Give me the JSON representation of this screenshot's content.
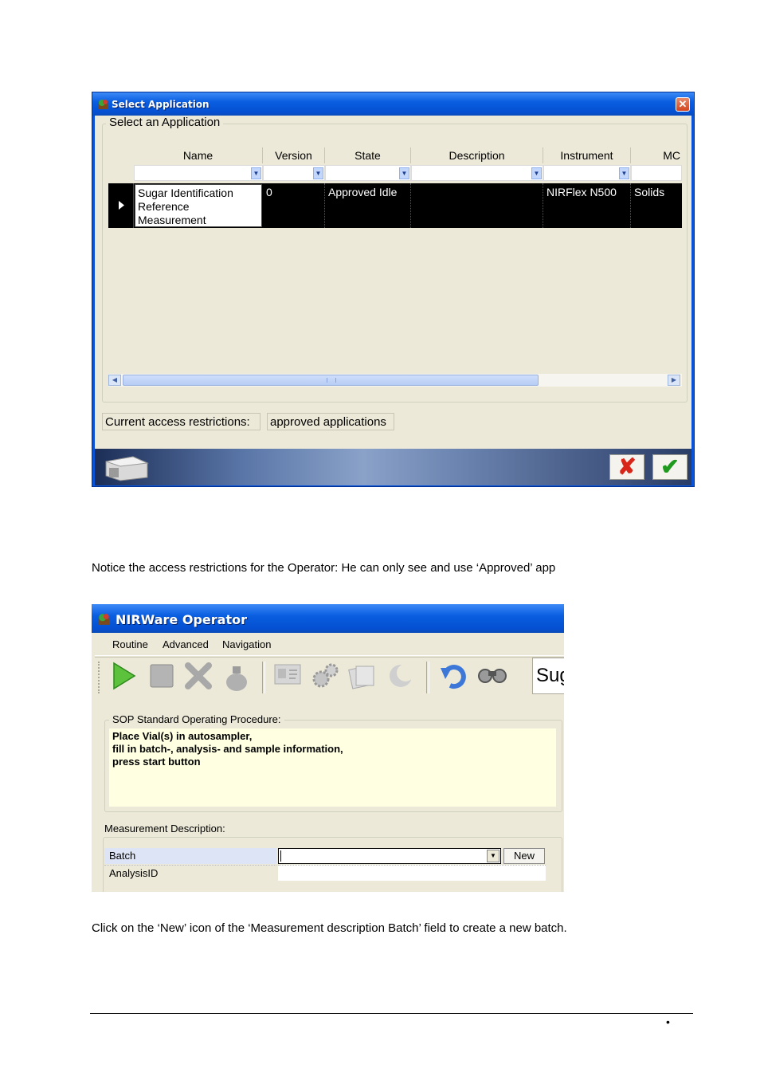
{
  "select_app_window": {
    "title": "Select Application",
    "group_label": "Select an Application",
    "columns": [
      "Name",
      "Version",
      "State",
      "Description",
      "Instrument",
      "MC"
    ],
    "row": {
      "name_line1": "Sugar Identification",
      "name_line2": "Reference",
      "name_line3": "Measurement",
      "version": "0",
      "state": "Approved Idle",
      "description": "",
      "instrument": "NIRFlex N500",
      "mc": "Solids"
    },
    "access_label": "Current access restrictions:",
    "access_value": "approved applications",
    "cancel_glyph": "✘",
    "ok_glyph": "✔"
  },
  "caption1": "Notice the access restrictions for the Operator: He can only see and use ‘Approved’ app",
  "operator_window": {
    "title": "NIRWare Operator",
    "menu": [
      "Routine",
      "Advanced",
      "Navigation"
    ],
    "app_name_partial": "Sug",
    "sop_label": "SOP Standard Operating Procedure:",
    "sop_lines": [
      "Place Vial(s) in autosampler,",
      "fill in batch-, analysis- and sample information,",
      "press start button"
    ],
    "measurement_label": "Measurement Description:",
    "batch_label": "Batch",
    "analysis_label": "AnalysisID",
    "new_button": "New",
    "toolbar_icons": [
      "play-icon",
      "stop-icon",
      "cancel-icon",
      "bag-icon",
      "id-card-icon",
      "gears-icon",
      "documents-icon",
      "moon-icon",
      "undo-icon",
      "binoculars-icon"
    ]
  },
  "caption2": "Click on the ‘New’ icon of the ‘Measurement description   Batch’ field to create a new batch.",
  "page_bullet": "•"
}
